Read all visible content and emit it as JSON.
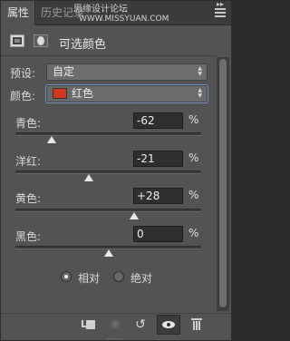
{
  "tabs": [
    {
      "label": "属性",
      "active": true
    },
    {
      "label": "历史记录",
      "active": false
    }
  ],
  "watermark": [
    "思缘设计论坛",
    "WWW.MISSYUAN.COM"
  ],
  "panel": {
    "title": "可选颜色"
  },
  "preset": {
    "label": "预设:",
    "value": "自定"
  },
  "colors": {
    "label": "颜色:",
    "value": "红色",
    "swatch": "#d2381d"
  },
  "sliders": [
    {
      "label": "青色:",
      "value": "-62",
      "unit": "%",
      "percent": -62
    },
    {
      "label": "洋红:",
      "value": "-21",
      "unit": "%",
      "percent": -21
    },
    {
      "label": "黄色:",
      "value": "+28",
      "unit": "%",
      "percent": 28
    },
    {
      "label": "黑色:",
      "value": "0",
      "unit": "%",
      "percent": 0
    }
  ],
  "method": {
    "options": [
      {
        "label": "相对",
        "selected": true
      },
      {
        "label": "绝对",
        "selected": false
      }
    ]
  },
  "icons": {
    "adjustment": "selective-color-icon",
    "mask": "mask-icon",
    "clip": "clip-to-layer-icon",
    "view_previous": "view-previous-state-icon",
    "reset": "reset-icon",
    "visibility": "eye-icon",
    "delete": "trash-icon"
  },
  "accent_color": "#6e95c4"
}
